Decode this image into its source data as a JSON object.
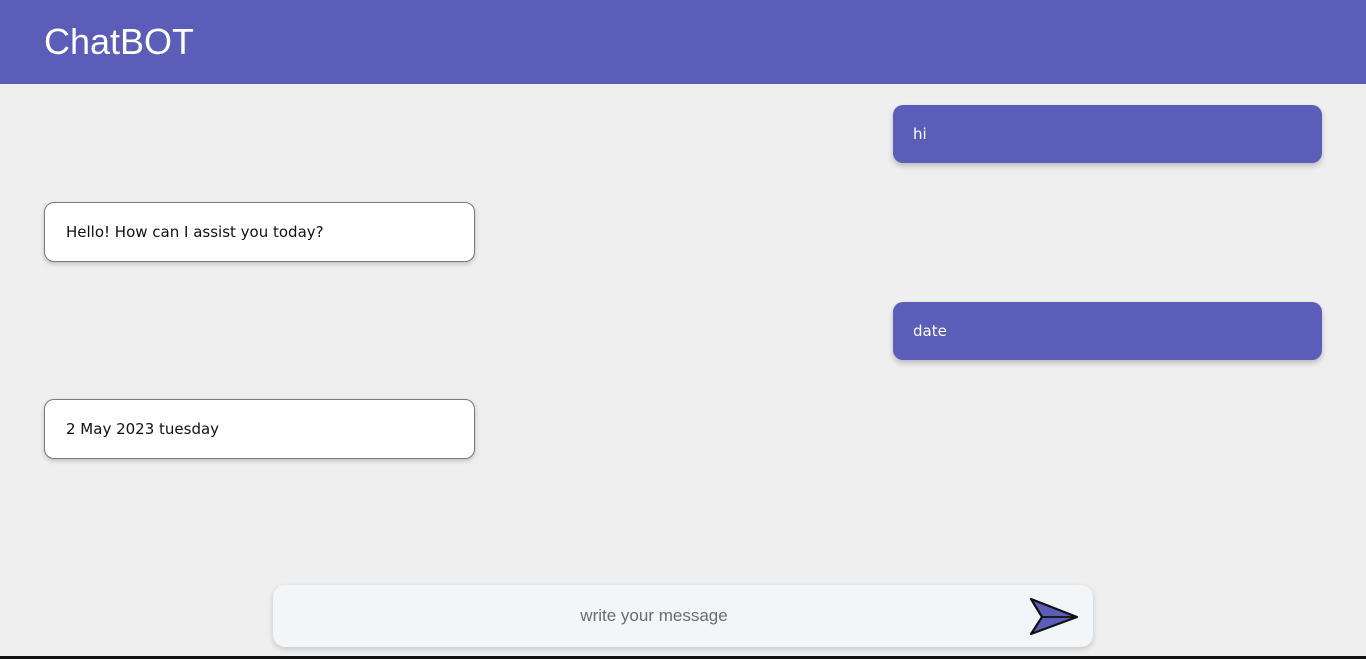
{
  "header": {
    "title": "ChatBOT"
  },
  "messages": [
    {
      "sender": "user",
      "text": "hi"
    },
    {
      "sender": "bot",
      "text": "Hello! How can I assist you today?"
    },
    {
      "sender": "user",
      "text": "date"
    },
    {
      "sender": "bot",
      "text": "2 May 2023 tuesday"
    }
  ],
  "composer": {
    "placeholder": "write your message",
    "value": ""
  },
  "colors": {
    "accent": "#5b5db9",
    "background": "#efefef",
    "bot_bubble": "#ffffff",
    "input_background": "#f3f6f9"
  },
  "icons": {
    "send": "send-arrow-icon"
  }
}
